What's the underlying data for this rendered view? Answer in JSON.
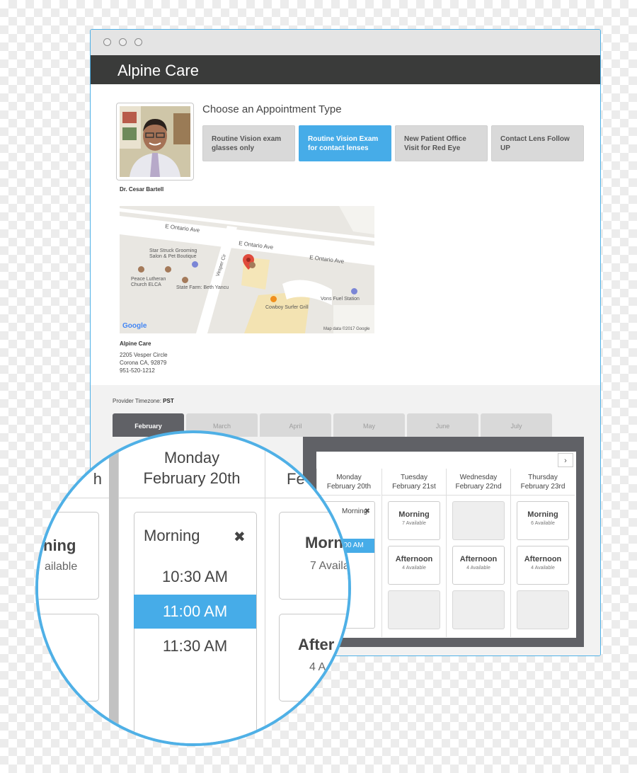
{
  "app": {
    "title": "Alpine Care"
  },
  "provider": {
    "name": "Dr. Cesar Bartell"
  },
  "appointment": {
    "heading": "Choose an Appointment Type",
    "types": [
      {
        "label": "Routine Vision exam glasses only",
        "selected": false
      },
      {
        "label": "Routine Vision Exam for contact lenses",
        "selected": true
      },
      {
        "label": "New Patient Office Visit for Red Eye",
        "selected": false
      },
      {
        "label": "Contact Lens Follow UP",
        "selected": false
      }
    ]
  },
  "map": {
    "streets": [
      "E Ontario Ave",
      "E Ontario Ave",
      "E Ontario Ave",
      "Vesper Cir"
    ],
    "places": [
      "Star Struck Grooming Salon & Pet Boutique",
      "Peace Lutheran Church ELCA",
      "State Farm: Beth Yancu",
      "Vons Fuel Station",
      "Cowboy Surfer Grill"
    ],
    "logo": "Google",
    "attribution": "Map data ©2017 Google"
  },
  "location": {
    "name": "Alpine Care",
    "address1": "2205 Vesper Circle",
    "address2": "Corona CA, 92879",
    "phone": "951-520-1212"
  },
  "calendar": {
    "timezone_label": "Provider Timezone:",
    "timezone": "PST",
    "months": [
      {
        "label": "February",
        "active": true
      },
      {
        "label": "March",
        "active": false
      },
      {
        "label": "April",
        "active": false
      },
      {
        "label": "May",
        "active": false
      },
      {
        "label": "June",
        "active": false
      },
      {
        "label": "July",
        "active": false
      }
    ],
    "next_arrow": "›",
    "days": [
      {
        "weekday": "Monday",
        "date": "February 20th",
        "morning": {
          "title": "Morning",
          "close": "✖",
          "times": [
            "10:30 AM",
            "11:00 AM",
            "11:30 AM"
          ],
          "selected_time": "11:00 AM"
        }
      },
      {
        "weekday": "Tuesday",
        "date": "February 21st",
        "slots": [
          {
            "title": "Morning",
            "sub": "7 Available"
          },
          {
            "title": "Afternoon",
            "sub": "4 Available"
          },
          null
        ]
      },
      {
        "weekday": "Wednesday",
        "date": "February 22nd",
        "slots": [
          null,
          {
            "title": "Afternoon",
            "sub": "4 Available"
          },
          null
        ]
      },
      {
        "weekday": "Thursday",
        "date": "February 23rd",
        "slots": [
          {
            "title": "Morning",
            "sub": "6 Available"
          },
          {
            "title": "Afternoon",
            "sub": "4 Available"
          },
          null
        ]
      }
    ]
  },
  "zoom": {
    "day_title_line1": "Monday",
    "day_title_line2": "February 20th",
    "left_partial_head": "h",
    "left_card_title": "ning",
    "left_card_sub": "ailable",
    "right_partial_head": "Fe",
    "right_card_title": "Morn",
    "right_card_sub": "7 Availa",
    "right_card2_title": "After",
    "right_card2_sub": "4 A",
    "morning_label": "Morning",
    "close_icon": "✖",
    "times": [
      "10:30 AM",
      "11:00 AM",
      "11:30 AM"
    ]
  }
}
